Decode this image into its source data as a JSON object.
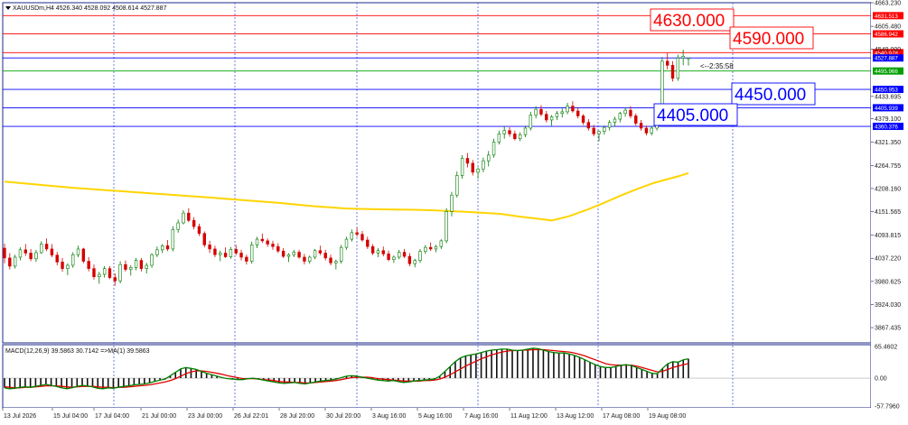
{
  "chart_data": {
    "type": "candlestick",
    "symbol_header": "XAUUSDm,H4  4526.340 4528.092 4508.614 4527.887",
    "countdown": "<--2:35:58",
    "y_ticks": [
      "4663.230",
      "4605.480",
      "4549.000",
      "4433.695",
      "4379.100",
      "4321.350",
      "4264.755",
      "4208.160",
      "4151.565",
      "4093.815",
      "4037.220",
      "3980.625",
      "3924.030",
      "3867.435"
    ],
    "x_ticks": [
      "13 Jul 2026",
      "15 Jul 04:00",
      "17 Jul 04:00",
      "21 Jul 00:00",
      "23 Jul 00:00",
      "26 Jul 22:01",
      "28 Jul 20:00",
      "30 Jul 20:00",
      "3 Aug 16:00",
      "5 Aug 16:00",
      "7 Aug 16:00",
      "11 Aug 12:00",
      "13 Aug 12:00",
      "17 Aug 08:00",
      "19 Aug 08:00"
    ],
    "price_lines": [
      {
        "price": 4631.513,
        "label": "4631.513",
        "color": "#ff0000"
      },
      {
        "price": 4586.942,
        "label": "4586.942",
        "color": "#ff0000"
      },
      {
        "price": 4540.978,
        "label": "4540.978",
        "color": "#ff0000"
      },
      {
        "price": 4527.887,
        "label": "4527.887",
        "color": "#0000ff"
      },
      {
        "price": 4495.966,
        "label": "4495.966",
        "color": "#00a000"
      },
      {
        "price": 4450.953,
        "label": "4450.953",
        "color": "#0000ff"
      },
      {
        "price": 4405.939,
        "label": "4405.939",
        "color": "#0000ff"
      },
      {
        "price": 4360.376,
        "label": "4360.376",
        "color": "#0000ff"
      }
    ],
    "big_labels": [
      {
        "text": "4630.000",
        "color": "#ff0000"
      },
      {
        "text": "4590.000",
        "color": "#ff0000"
      },
      {
        "text": "4450.000",
        "color": "#0000ff"
      },
      {
        "text": "4405.000",
        "color": "#0000ff"
      }
    ],
    "moving_average": [
      [
        0,
        4225
      ],
      [
        20,
        4210
      ],
      [
        40,
        4198
      ],
      [
        60,
        4186
      ],
      [
        80,
        4173
      ],
      [
        90,
        4165
      ],
      [
        100,
        4159
      ],
      [
        110,
        4157
      ],
      [
        120,
        4156
      ],
      [
        125,
        4155
      ],
      [
        135,
        4151
      ],
      [
        145,
        4146
      ],
      [
        150,
        4140
      ],
      [
        155,
        4135
      ],
      [
        160,
        4130
      ],
      [
        165,
        4140
      ],
      [
        170,
        4155
      ],
      [
        175,
        4172
      ],
      [
        180,
        4190
      ],
      [
        185,
        4207
      ],
      [
        190,
        4222
      ],
      [
        197,
        4238
      ],
      [
        200,
        4246
      ]
    ],
    "candles": [
      [
        4062,
        4073,
        4025,
        4038
      ],
      [
        4038,
        4050,
        4010,
        4018
      ],
      [
        4018,
        4046,
        4012,
        4040
      ],
      [
        4040,
        4064,
        4032,
        4058
      ],
      [
        4058,
        4072,
        4043,
        4050
      ],
      [
        4050,
        4060,
        4030,
        4036
      ],
      [
        4036,
        4058,
        4028,
        4051
      ],
      [
        4051,
        4079,
        4048,
        4072
      ],
      [
        4072,
        4086,
        4055,
        4060
      ],
      [
        4060,
        4072,
        4040,
        4045
      ],
      [
        4045,
        4053,
        4020,
        4028
      ],
      [
        4028,
        4038,
        4004,
        4012
      ],
      [
        4012,
        4025,
        3996,
        4020
      ],
      [
        4020,
        4052,
        4014,
        4046
      ],
      [
        4046,
        4068,
        4040,
        4060
      ],
      [
        4060,
        4063,
        4025,
        4030
      ],
      [
        4030,
        4040,
        4005,
        4012
      ],
      [
        4012,
        4022,
        3985,
        3992
      ],
      [
        3992,
        4004,
        3975,
        3998
      ],
      [
        3998,
        4018,
        3990,
        4012
      ],
      [
        4012,
        4018,
        3986,
        3990
      ],
      [
        3990,
        4000,
        3970,
        3982
      ],
      [
        3982,
        4030,
        3976,
        4022
      ],
      [
        4022,
        4032,
        4005,
        4010
      ],
      [
        4010,
        4020,
        3995,
        4015
      ],
      [
        4015,
        4038,
        4008,
        4032
      ],
      [
        4032,
        4038,
        4005,
        4012
      ],
      [
        4012,
        4026,
        4000,
        4020
      ],
      [
        4020,
        4050,
        4014,
        4046
      ],
      [
        4046,
        4066,
        4040,
        4058
      ],
      [
        4058,
        4072,
        4050,
        4068
      ],
      [
        4068,
        4082,
        4055,
        4060
      ],
      [
        4060,
        4116,
        4054,
        4108
      ],
      [
        4108,
        4132,
        4100,
        4124
      ],
      [
        4124,
        4155,
        4120,
        4148
      ],
      [
        4148,
        4160,
        4126,
        4130
      ],
      [
        4130,
        4138,
        4108,
        4115
      ],
      [
        4115,
        4122,
        4092,
        4098
      ],
      [
        4098,
        4103,
        4064,
        4070
      ],
      [
        4070,
        4080,
        4050,
        4060
      ],
      [
        4060,
        4068,
        4040,
        4046
      ],
      [
        4046,
        4056,
        4030,
        4050
      ],
      [
        4050,
        4064,
        4038,
        4041
      ],
      [
        4041,
        4065,
        4036,
        4059
      ],
      [
        4059,
        4070,
        4045,
        4050
      ],
      [
        4050,
        4058,
        4032,
        4040
      ],
      [
        4040,
        4046,
        4022,
        4030
      ],
      [
        4030,
        4078,
        4024,
        4070
      ],
      [
        4070,
        4090,
        4062,
        4084
      ],
      [
        4084,
        4098,
        4075,
        4080
      ],
      [
        4080,
        4086,
        4065,
        4072
      ],
      [
        4072,
        4080,
        4058,
        4066
      ],
      [
        4066,
        4074,
        4050,
        4055
      ],
      [
        4055,
        4062,
        4038,
        4042
      ],
      [
        4042,
        4050,
        4028,
        4046
      ],
      [
        4046,
        4058,
        4040,
        4052
      ],
      [
        4052,
        4058,
        4036,
        4040
      ],
      [
        4040,
        4048,
        4022,
        4030
      ],
      [
        4030,
        4044,
        4024,
        4040
      ],
      [
        4040,
        4060,
        4035,
        4056
      ],
      [
        4056,
        4068,
        4045,
        4050
      ],
      [
        4050,
        4058,
        4032,
        4038
      ],
      [
        4038,
        4046,
        4020,
        4026
      ],
      [
        4026,
        4034,
        4010,
        4030
      ],
      [
        4030,
        4070,
        4024,
        4064
      ],
      [
        4064,
        4090,
        4058,
        4084
      ],
      [
        4084,
        4108,
        4078,
        4100
      ],
      [
        4100,
        4112,
        4090,
        4096
      ],
      [
        4096,
        4104,
        4078,
        4082
      ],
      [
        4082,
        4090,
        4060,
        4066
      ],
      [
        4066,
        4072,
        4045,
        4050
      ],
      [
        4050,
        4062,
        4040,
        4056
      ],
      [
        4056,
        4066,
        4042,
        4048
      ],
      [
        4048,
        4056,
        4030,
        4034
      ],
      [
        4034,
        4044,
        4026,
        4040
      ],
      [
        4040,
        4058,
        4035,
        4052
      ],
      [
        4052,
        4060,
        4038,
        4042
      ],
      [
        4042,
        4050,
        4018,
        4024
      ],
      [
        4024,
        4036,
        4015,
        4032
      ],
      [
        4032,
        4060,
        4026,
        4054
      ],
      [
        4054,
        4070,
        4048,
        4064
      ],
      [
        4064,
        4076,
        4055,
        4060
      ],
      [
        4060,
        4070,
        4052,
        4066
      ],
      [
        4066,
        4084,
        4060,
        4080
      ],
      [
        4080,
        4160,
        4074,
        4152
      ],
      [
        4152,
        4200,
        4140,
        4192
      ],
      [
        4192,
        4250,
        4186,
        4240
      ],
      [
        4240,
        4290,
        4232,
        4282
      ],
      [
        4282,
        4295,
        4260,
        4270
      ],
      [
        4270,
        4278,
        4240,
        4248
      ],
      [
        4248,
        4260,
        4232,
        4256
      ],
      [
        4256,
        4284,
        4248,
        4276
      ],
      [
        4276,
        4300,
        4262,
        4290
      ],
      [
        4290,
        4330,
        4284,
        4322
      ],
      [
        4322,
        4350,
        4316,
        4342
      ],
      [
        4342,
        4360,
        4330,
        4350
      ],
      [
        4350,
        4358,
        4335,
        4342
      ],
      [
        4342,
        4350,
        4326,
        4330
      ],
      [
        4330,
        4346,
        4324,
        4340
      ],
      [
        4340,
        4362,
        4334,
        4356
      ],
      [
        4356,
        4396,
        4350,
        4388
      ],
      [
        4388,
        4410,
        4380,
        4402
      ],
      [
        4402,
        4412,
        4385,
        4390
      ],
      [
        4390,
        4398,
        4370,
        4376
      ],
      [
        4376,
        4388,
        4362,
        4384
      ],
      [
        4384,
        4398,
        4376,
        4392
      ],
      [
        4392,
        4404,
        4382,
        4396
      ],
      [
        4396,
        4418,
        4390,
        4410
      ],
      [
        4410,
        4422,
        4394,
        4398
      ],
      [
        4398,
        4406,
        4380,
        4386
      ],
      [
        4386,
        4390,
        4364,
        4370
      ],
      [
        4370,
        4378,
        4350,
        4356
      ],
      [
        4356,
        4364,
        4336,
        4342
      ],
      [
        4342,
        4350,
        4324,
        4348
      ],
      [
        4348,
        4362,
        4340,
        4358
      ],
      [
        4358,
        4376,
        4350,
        4370
      ],
      [
        4370,
        4384,
        4360,
        4378
      ],
      [
        4378,
        4396,
        4370,
        4392
      ],
      [
        4392,
        4406,
        4384,
        4400
      ],
      [
        4400,
        4410,
        4380,
        4386
      ],
      [
        4386,
        4392,
        4362,
        4368
      ],
      [
        4368,
        4376,
        4350,
        4356
      ],
      [
        4356,
        4362,
        4338,
        4344
      ],
      [
        4344,
        4360,
        4338,
        4356
      ],
      [
        4356,
        4400,
        4350,
        4394
      ],
      [
        4394,
        4530,
        4388,
        4520
      ],
      [
        4520,
        4540,
        4500,
        4510
      ],
      [
        4510,
        4520,
        4470,
        4478
      ],
      [
        4478,
        4536,
        4472,
        4528
      ],
      [
        4528,
        4548,
        4510,
        4532
      ],
      [
        4526,
        4528,
        4509,
        4528
      ]
    ],
    "macd_header": "MACD(12,26,9) 39.5863 30.7142  =>MA(1) 39.5863",
    "macd_ticks": [
      "65.4602",
      "0.00",
      "-57.7960"
    ],
    "macd_ylim": [
      -57.796,
      65.4602
    ],
    "macd_hist": [
      -20,
      -22,
      -21,
      -19,
      -18,
      -19,
      -17,
      -15,
      -13,
      -15,
      -17,
      -20,
      -22,
      -20,
      -17,
      -15,
      -16,
      -18,
      -21,
      -22,
      -20,
      -21,
      -19,
      -17,
      -16,
      -14,
      -13,
      -12,
      -10,
      -7,
      -4,
      -2,
      5,
      12,
      19,
      22,
      20,
      18,
      14,
      10,
      7,
      4,
      1,
      -1,
      -2,
      -3,
      -3,
      -1,
      0,
      -2,
      -4,
      -6,
      -8,
      -10,
      -11,
      -10,
      -9,
      -11,
      -12,
      -10,
      -8,
      -6,
      -5,
      -4,
      -2,
      1,
      4,
      5,
      4,
      2,
      0,
      -2,
      -4,
      -5,
      -6,
      -5,
      -7,
      -9,
      -8,
      -6,
      -5,
      -4,
      -3,
      -2,
      4,
      14,
      24,
      34,
      42,
      46,
      48,
      50,
      53,
      56,
      58,
      59,
      60,
      60,
      58,
      57,
      58,
      60,
      62,
      61,
      58,
      55,
      53,
      52,
      52,
      50,
      47,
      43,
      38,
      33,
      28,
      24,
      22,
      22,
      24,
      27,
      28,
      26,
      22,
      18,
      14,
      10,
      9,
      20,
      30,
      34,
      33,
      38,
      40
    ],
    "macd_signal": [
      -18,
      -19,
      -20,
      -20,
      -19,
      -19,
      -18,
      -17,
      -16,
      -16,
      -16,
      -17,
      -18,
      -19,
      -18,
      -17,
      -17,
      -17,
      -18,
      -19,
      -19,
      -20,
      -19,
      -19,
      -18,
      -17,
      -16,
      -15,
      -14,
      -12,
      -10,
      -8,
      -5,
      -1,
      4,
      9,
      13,
      15,
      15,
      14,
      12,
      10,
      8,
      5,
      3,
      1,
      -1,
      -1,
      -1,
      -2,
      -3,
      -4,
      -5,
      -7,
      -8,
      -8,
      -9,
      -9,
      -10,
      -10,
      -9,
      -8,
      -7,
      -6,
      -5,
      -3,
      -1,
      1,
      2,
      2,
      2,
      1,
      -1,
      -2,
      -3,
      -4,
      -5,
      -6,
      -6,
      -6,
      -6,
      -5,
      -5,
      -4,
      -2,
      2,
      7,
      13,
      19,
      25,
      30,
      35,
      40,
      44,
      48,
      51,
      54,
      56,
      57,
      57,
      58,
      58,
      59,
      59,
      59,
      58,
      57,
      56,
      55,
      54,
      52,
      49,
      46,
      42,
      38,
      34,
      30,
      28,
      27,
      27,
      27,
      27,
      25,
      22,
      19,
      16,
      13,
      14,
      18,
      22,
      25,
      28,
      30
    ],
    "colors": {
      "bull": "#007a00",
      "bear": "#d40000",
      "ma": "#ffd400",
      "grid": "#4a5fcf",
      "macd_bar": "#111111",
      "macd_green": "#008000",
      "macd_red": "#e00000"
    }
  }
}
